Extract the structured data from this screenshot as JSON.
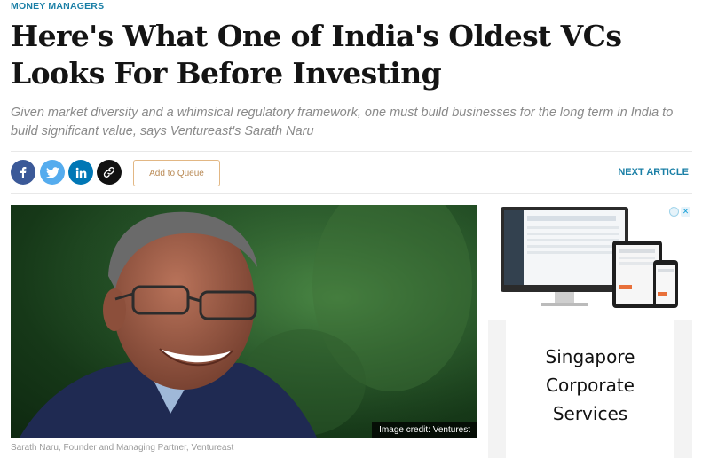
{
  "category": "MONEY MANAGERS",
  "headline": "Here's What One of India's Oldest VCs Looks For Before Investing",
  "dek": "Given market diversity and a whimsical regulatory framework, one must build businesses for the long term in India to build significant value, says Ventureast's Sarath Naru",
  "share": {
    "icons": [
      "facebook-icon",
      "twitter-icon",
      "linkedin-icon",
      "link-icon"
    ],
    "colors": {
      "facebook": "#3b5998",
      "twitter": "#55acee",
      "linkedin": "#0077b5",
      "link": "#111111"
    }
  },
  "queue_button": "Add to Queue",
  "next_article": "NEXT ARTICLE",
  "image": {
    "credit": "Image credit: Venturest",
    "caption": "Sarath Naru, Founder and Managing Partner, Ventureast"
  },
  "ad": {
    "text": "Singapore Corporate Services",
    "icons": [
      "adchoices-icon",
      "close-icon"
    ]
  }
}
